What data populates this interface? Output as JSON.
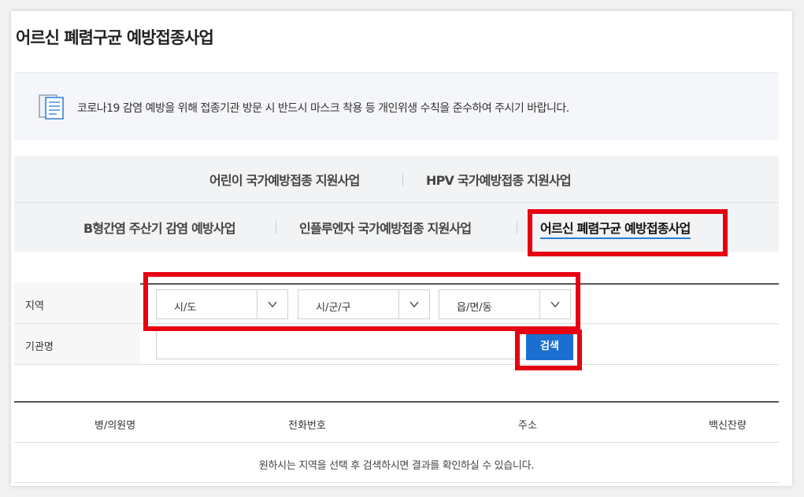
{
  "page": {
    "title": "어르신 폐렴구균 예방접종사업"
  },
  "notice": {
    "icon": "document-list-icon",
    "text": "코로나19 감염 예방을 위해 접종기관 방문 시 반드시 마스크 착용 등 개인위생 수칙을 준수하여 주시기 바랍니다."
  },
  "tabs": {
    "row1": [
      "어린이 국가예방접종 지원사업",
      "HPV 국가예방접종 지원사업"
    ],
    "row2": [
      "B형간염 주산기 감염 예방사업",
      "인플루엔자 국가예방접종 지원사업",
      "어르신 폐렴구균 예방접종사업"
    ],
    "active": "어르신 폐렴구균 예방접종사업"
  },
  "form": {
    "region_label": "지역",
    "selects": {
      "sido": "시/도",
      "sigungu": "시/군/구",
      "eupmyeondong": "읍/면/동"
    },
    "institution_label": "기관명",
    "institution_value": "",
    "search_label": "검색"
  },
  "results": {
    "columns": [
      "병/의원명",
      "전화번호",
      "주소",
      "백신잔량"
    ],
    "empty_message": "원하시는 지역을 선택 후 검색하시면 결과를 확인하실 수 있습니다."
  },
  "colors": {
    "accent": "#1a6fd1",
    "highlight": "#e60012",
    "active_underline": "#2b7bd6"
  }
}
